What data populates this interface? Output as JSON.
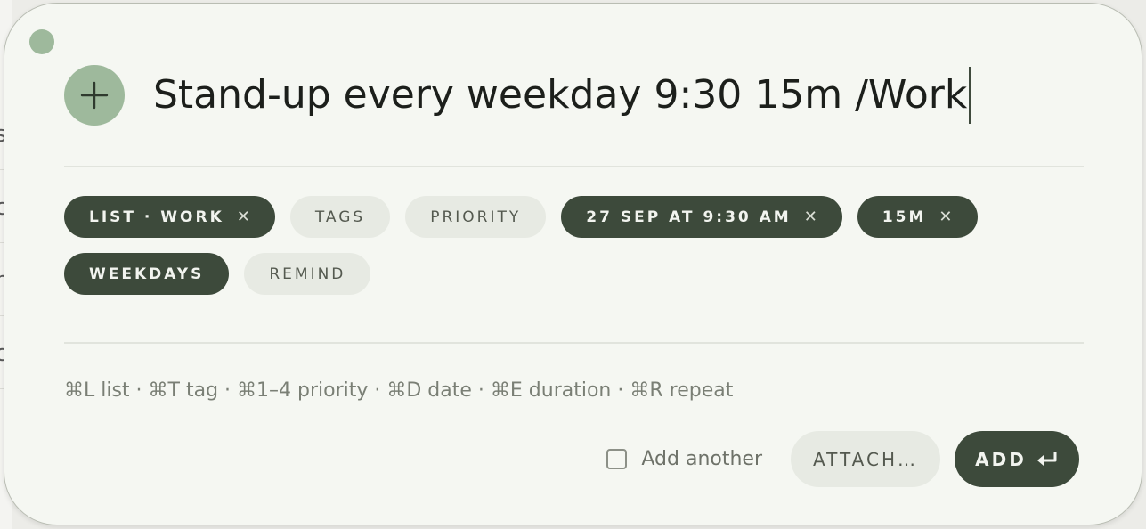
{
  "background_app": {
    "fragments": [
      "s",
      "c",
      "n",
      "c"
    ]
  },
  "composer": {
    "input_value": "Stand-up every weekday 9:30 15m /Work",
    "add_icon": "plus-icon",
    "chips_row1": [
      {
        "label": "LIST · WORK",
        "active": true,
        "removable": true
      },
      {
        "label": "TAGS",
        "active": false,
        "removable": false
      },
      {
        "label": "PRIORITY",
        "active": false,
        "removable": false
      },
      {
        "label": "27 SEP AT 9:30 AM",
        "active": true,
        "removable": true
      },
      {
        "label": "15M",
        "active": true,
        "removable": true
      }
    ],
    "chips_row2": [
      {
        "label": "WEEKDAYS",
        "active": true,
        "removable": false
      },
      {
        "label": "REMIND",
        "active": false,
        "removable": false
      }
    ],
    "chip_remove_glyph": "✕",
    "shortcuts_hint": "⌘L list · ⌘T tag · ⌘1–4 priority · ⌘D date · ⌘E duration · ⌘R repeat",
    "add_another_label": "Add another",
    "add_another_checked": false,
    "attach_label": "ATTACH…",
    "add_label": "ADD",
    "add_icon_enter": "enter-return-icon"
  },
  "colors": {
    "panel_bg": "#f5f7f2",
    "accent_dark": "#3d4a3b",
    "accent_green": "#9eb99c",
    "chip_light": "#e7eae3"
  }
}
